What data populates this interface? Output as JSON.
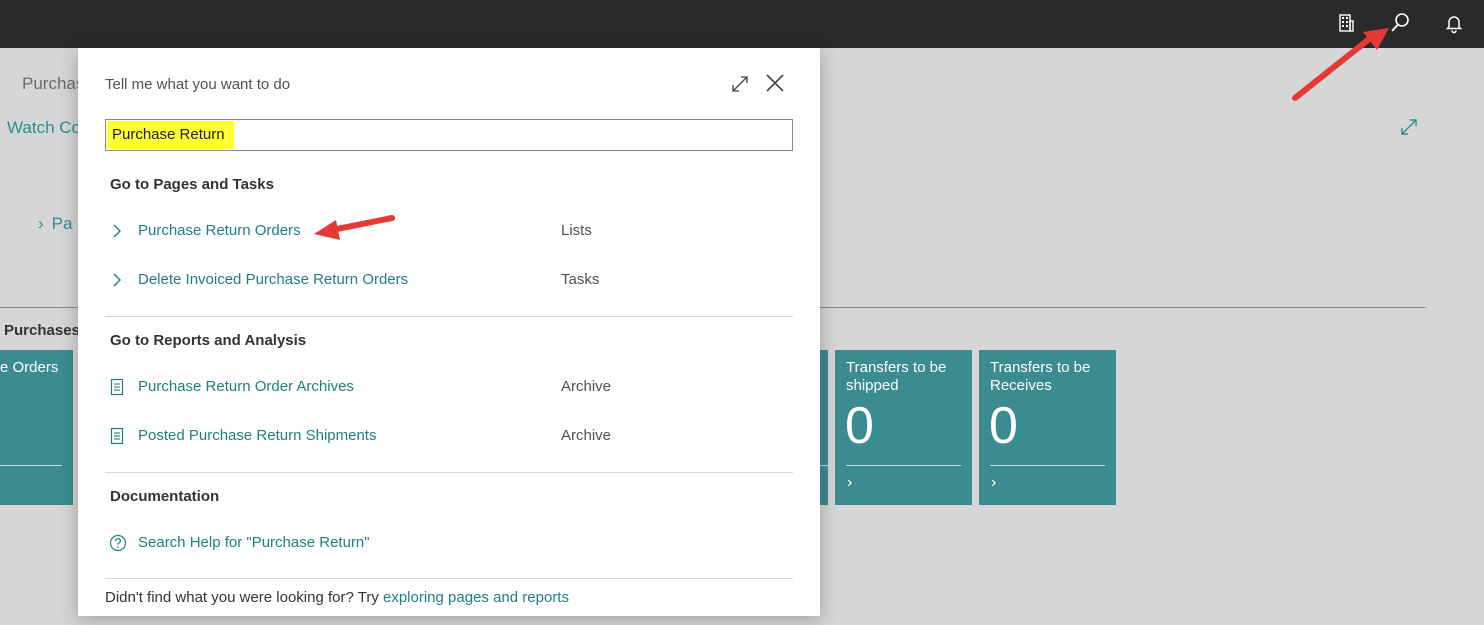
{
  "topbar": {
    "icons": [
      "company-icon",
      "search-icon",
      "notification-bell-icon"
    ]
  },
  "background": {
    "page_title": "Purchas",
    "watch_label": "Watch Co",
    "nav_item": "Pa",
    "section_label": "Purchases",
    "tiles": [
      {
        "title": "e Orders",
        "value": ""
      },
      {
        "title": "Transfers to be shipped",
        "value": "0"
      },
      {
        "title": "Transfers to be Receives",
        "value": "0"
      }
    ]
  },
  "dialog": {
    "title": "Tell me what you want to do",
    "search": {
      "value": "Purchase Return",
      "highlight": "#ffff33"
    },
    "sections": [
      {
        "heading": "Go to Pages and Tasks",
        "items": [
          {
            "label": "Purchase Return Orders",
            "category": "Lists",
            "icon": "chevron-right-icon"
          },
          {
            "label": "Delete Invoiced Purchase Return Orders",
            "category": "Tasks",
            "icon": "chevron-right-icon"
          }
        ]
      },
      {
        "heading": "Go to Reports and Analysis",
        "items": [
          {
            "label": "Purchase Return Order Archives",
            "category": "Archive",
            "icon": "report-icon"
          },
          {
            "label": "Posted Purchase Return Shipments",
            "category": "Archive",
            "icon": "report-icon"
          }
        ]
      },
      {
        "heading": "Documentation",
        "items": [
          {
            "label": "Search Help for \"Purchase Return\"",
            "category": "",
            "icon": "help-icon"
          }
        ]
      }
    ],
    "footer": {
      "text": "Didn't find what you were looking for? Try ",
      "link": "exploring pages and reports"
    }
  },
  "colors": {
    "accent": "#1e7f83",
    "tile": "#3b8c91",
    "topbar": "#2a2a2a",
    "annotation_arrow": "#e53935"
  }
}
